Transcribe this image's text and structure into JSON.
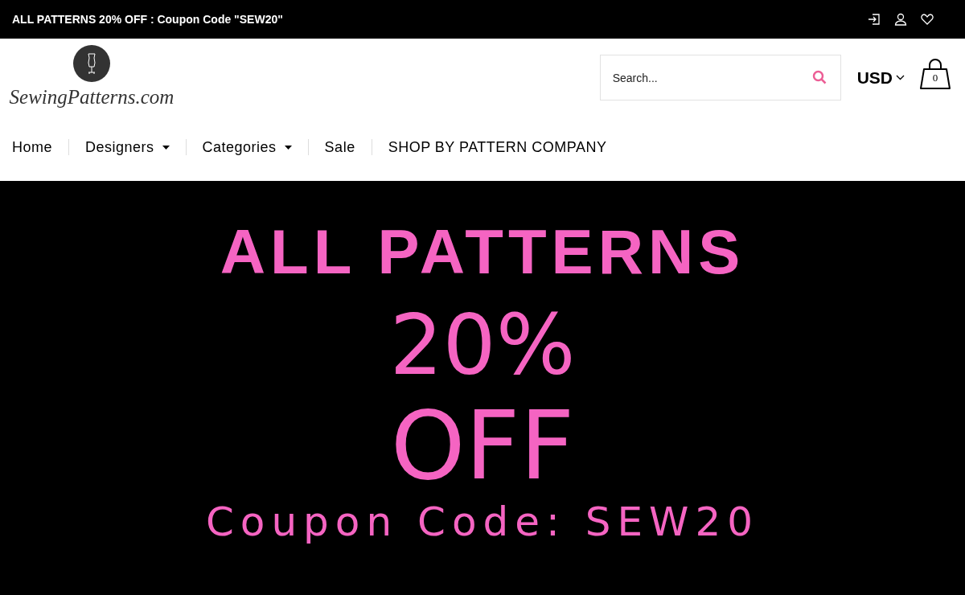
{
  "announcement": "ALL PATTERNS 20% OFF : Coupon Code \"SEW20\"",
  "logo": {
    "text": "SewingPatterns.com"
  },
  "search": {
    "placeholder": "Search..."
  },
  "currency": "USD",
  "cart": {
    "count": "0"
  },
  "nav": [
    {
      "label": "Home",
      "dropdown": false
    },
    {
      "label": "Designers",
      "dropdown": true
    },
    {
      "label": "Categories",
      "dropdown": true
    },
    {
      "label": "Sale",
      "dropdown": false
    },
    {
      "label": "SHOP BY PATTERN COMPANY",
      "dropdown": false
    }
  ],
  "hero": {
    "lines": [
      {
        "kind": "heavy",
        "text": "ALL PATTERNS"
      },
      {
        "kind": "big",
        "text": "20%"
      },
      {
        "kind": "huge",
        "text": "OFF"
      },
      {
        "kind": "spaced",
        "text": "Coupon Code: SEW20"
      }
    ]
  }
}
